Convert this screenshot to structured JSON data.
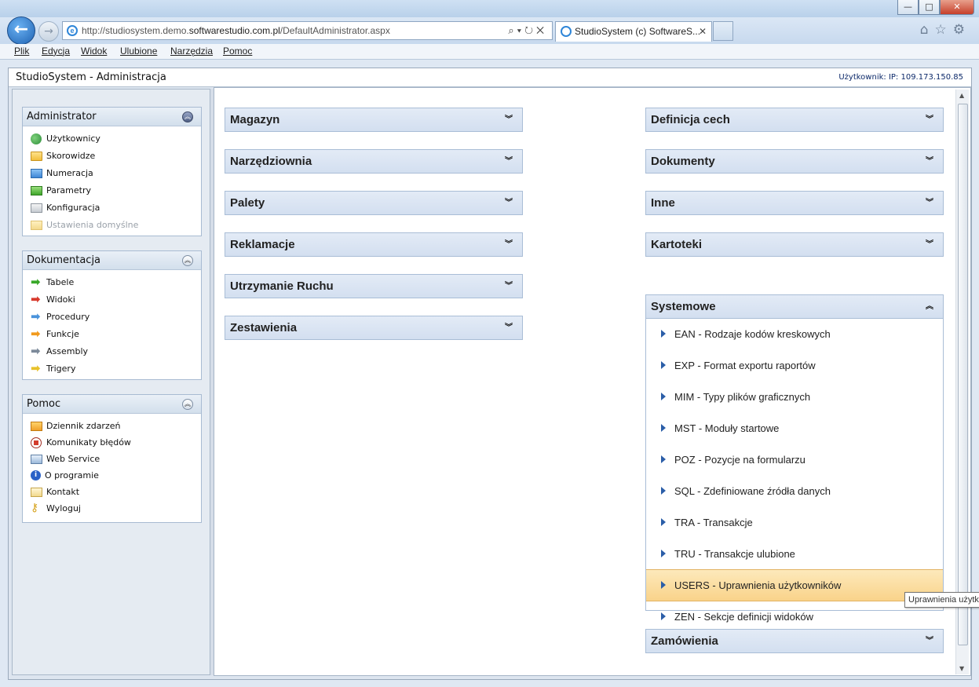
{
  "browser": {
    "url_prefix": "http://studiosystem.demo.",
    "url_domain": "softwarestudio.com.pl",
    "url_path": "/DefaultAdministrator.aspx",
    "tab_title": "StudioSystem (c) SoftwareS...",
    "menu": [
      "Plik",
      "Edycja",
      "Widok",
      "Ulubione",
      "Narzędzia",
      "Pomoc"
    ]
  },
  "app": {
    "title": "StudioSystem - Administracja",
    "user_info": "Użytkownik: IP: 109.173.150.85"
  },
  "sidebar": {
    "panels": [
      {
        "title": "Administrator",
        "items": [
          {
            "label": "Użytkownicy",
            "icon": "users-icon"
          },
          {
            "label": "Skorowidze",
            "icon": "folder-icon"
          },
          {
            "label": "Numeracja",
            "icon": "folder-icon"
          },
          {
            "label": "Parametry",
            "icon": "folder-icon"
          },
          {
            "label": "Konfiguracja",
            "icon": "folder-icon"
          },
          {
            "label": "Ustawienia domyślne",
            "icon": "folder-icon",
            "disabled": true
          }
        ]
      },
      {
        "title": "Dokumentacja",
        "items": [
          {
            "label": "Tabele",
            "icon": "arrow-right-icon"
          },
          {
            "label": "Widoki",
            "icon": "arrow-right-icon"
          },
          {
            "label": "Procedury",
            "icon": "arrow-right-icon"
          },
          {
            "label": "Funkcje",
            "icon": "arrow-right-icon"
          },
          {
            "label": "Assembly",
            "icon": "arrow-right-icon"
          },
          {
            "label": "Trigery",
            "icon": "arrow-right-icon"
          }
        ]
      },
      {
        "title": "Pomoc",
        "items": [
          {
            "label": "Dziennik zdarzeń",
            "icon": "log-icon"
          },
          {
            "label": "Komunikaty błędów",
            "icon": "stop-icon"
          },
          {
            "label": "Web Service",
            "icon": "web-service-icon"
          },
          {
            "label": "O programie",
            "icon": "info-icon"
          },
          {
            "label": "Kontakt",
            "icon": "mail-icon"
          },
          {
            "label": "Wyloguj",
            "icon": "key-icon"
          }
        ]
      }
    ]
  },
  "main": {
    "left_sections": [
      "Magazyn",
      "Narzędziownia",
      "Palety",
      "Reklamacje",
      "Utrzymanie Ruchu",
      "Zestawienia"
    ],
    "right_sections": [
      "Definicja cech",
      "Dokumenty",
      "Inne",
      "Kartoteki"
    ],
    "systemowe": {
      "title": "Systemowe",
      "items": [
        "EAN - Rodzaje kodów kreskowych",
        "EXP - Format exportu raportów",
        "MIM - Typy plików graficznych",
        "MST - Moduły startowe",
        "POZ - Pozycje na formularzu",
        "SQL - Zdefiniowane źródła danych",
        "TRA - Transakcje",
        "TRU - Transakcje ulubione",
        "USERS - Uprawnienia użytkowników",
        "ZEN - Sekcje definicji widoków"
      ],
      "highlighted_index": 8
    },
    "zamowienia": "Zamówienia",
    "tooltip": "Uprawnienia użytkowników"
  }
}
